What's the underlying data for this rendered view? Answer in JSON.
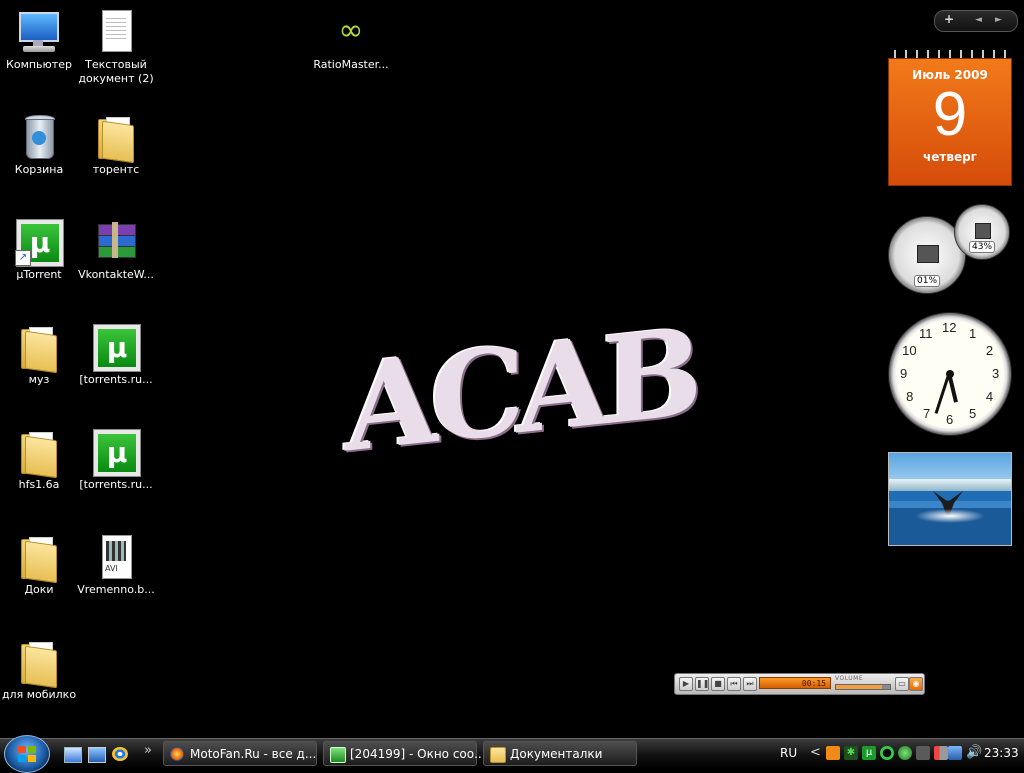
{
  "desktop": {
    "icons": [
      {
        "label": "Компьютер"
      },
      {
        "label": "Текстовый документ (2)"
      },
      {
        "label": "RatioMaster..."
      },
      {
        "label": "Корзина"
      },
      {
        "label": "торентс"
      },
      {
        "label": "µTorrent"
      },
      {
        "label": "VkontakteW..."
      },
      {
        "label": "муз"
      },
      {
        "label": "[torrents.ru..."
      },
      {
        "label": "hfs1.6a"
      },
      {
        "label": "[torrents.ru..."
      },
      {
        "label": "Доки"
      },
      {
        "label": "Vremenno.b..."
      },
      {
        "label": "для мобилко"
      }
    ]
  },
  "wallpaper_text": "ACAB",
  "sidebar": {
    "controls": {
      "add": "+",
      "prev": "◄",
      "next": "►"
    },
    "calendar": {
      "month_year": "Июль 2009",
      "day": "9",
      "weekday": "четверг"
    },
    "cpu_meter": {
      "cpu": "01%",
      "memory": "43%"
    },
    "clock": {
      "hour": 5,
      "minute": 33,
      "numbers": [
        "12",
        "1",
        "2",
        "3",
        "4",
        "5",
        "6",
        "7",
        "8",
        "9",
        "10",
        "11"
      ]
    }
  },
  "media_player": {
    "display": "00:15",
    "volume_label": "VOLUME",
    "volume_level": 0.85
  },
  "taskbar": {
    "tasks": [
      {
        "label": "MotoFan.Ru - все д..."
      },
      {
        "label": "[204199] - Окно соо..."
      },
      {
        "label": "Документалки"
      }
    ],
    "quicklaunch_more": "»",
    "tray": {
      "language": "RU",
      "expand": "<",
      "time": "23:33"
    }
  }
}
